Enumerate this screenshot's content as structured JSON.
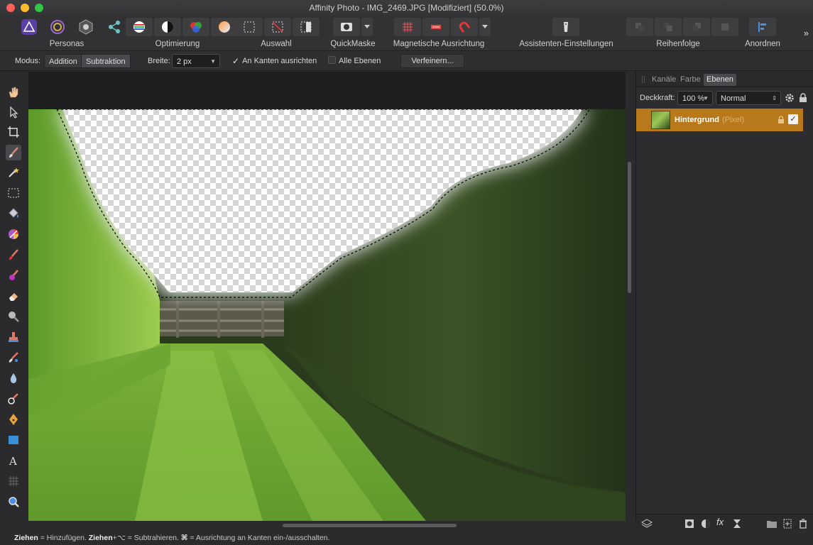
{
  "window": {
    "title": "Affinity Photo - IMG_2469.JPG [Modifiziert] (50.0%)"
  },
  "toolbar": {
    "groups": [
      {
        "label": "Personas"
      },
      {
        "label": "Optimierung"
      },
      {
        "label": "Auswahl"
      },
      {
        "label": "QuickMaske"
      },
      {
        "label": "Magnetische Ausrichtung"
      },
      {
        "label": "Assistenten-Einstellungen"
      },
      {
        "label": "Reihenfolge"
      },
      {
        "label": "Anordnen"
      }
    ],
    "more": "»"
  },
  "context": {
    "mode_label": "Modus:",
    "mode_add": "Addition",
    "mode_sub": "Subtraktion",
    "width_label": "Breite:",
    "width_value": "2 px",
    "snap_edges": "An Kanten ausrichten",
    "all_layers": "Alle Ebenen",
    "refine": "Verfeinern..."
  },
  "panel": {
    "tabs": [
      "Kanäle",
      "Farbe",
      "Ebenen"
    ],
    "opacity_label": "Deckkraft:",
    "opacity_value": "100 %",
    "blend_mode": "Normal",
    "layer": {
      "name": "Hintergrund",
      "type": "(Pixel)"
    }
  },
  "status": {
    "b1": "Ziehen",
    "t1": " = Hinzufügen. ",
    "b2": "Ziehen",
    "t2": "+⌥ = Subtrahieren. ",
    "b3": "⌘",
    "t3": " = Ausrichtung an Kanten ein-/ausschalten."
  },
  "colors": {
    "accent_layer": "#b8791b",
    "mac_red": "#fc5f57",
    "mac_yellow": "#fdbc2e",
    "mac_green": "#33c748"
  }
}
